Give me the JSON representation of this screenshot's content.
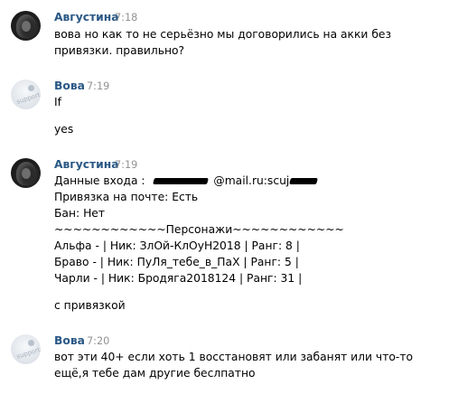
{
  "messages": [
    {
      "author": "Августина",
      "time": "7:18",
      "avatar": "dark-girl-avatar",
      "lines": [
        "вова но как то не серьёзно мы договорились на акки без",
        "привязки. правильно?"
      ]
    },
    {
      "author": "Вова",
      "time": "7:19",
      "avatar": "support-avatar",
      "lines": [
        "If",
        "yes"
      ]
    },
    {
      "author": "Августина",
      "time": "7:19",
      "avatar": "dark-girl-avatar",
      "login_prefix": "Данные входа :",
      "login_mail": "@mail.ru:scuj",
      "lines": [
        "Привязка на почте: Есть",
        "Бан: Нет",
        "~~~~~~~~~~~~Персонажи~~~~~~~~~~~~",
        "Альфа - | Ник: ЗлОй-КлОуН2018 | Ранг: 8 |",
        "Браво - | Ник: ПуЛя_тебе_в_ПаХ | Ранг: 5 |",
        "Чарли - | Ник: Бродяга2018124 | Ранг: 31 |",
        "с привязкой"
      ]
    },
    {
      "author": "Вова",
      "time": "7:20",
      "avatar": "support-avatar",
      "lines": [
        "вот эти 40+ если хоть 1 восстановят или забанят или что-то",
        "ещё,я тебе дам другие беслпатно"
      ]
    }
  ],
  "support_label": "support",
  "colors": {
    "author": "#2a5885",
    "time": "#939393",
    "text": "#000000"
  }
}
